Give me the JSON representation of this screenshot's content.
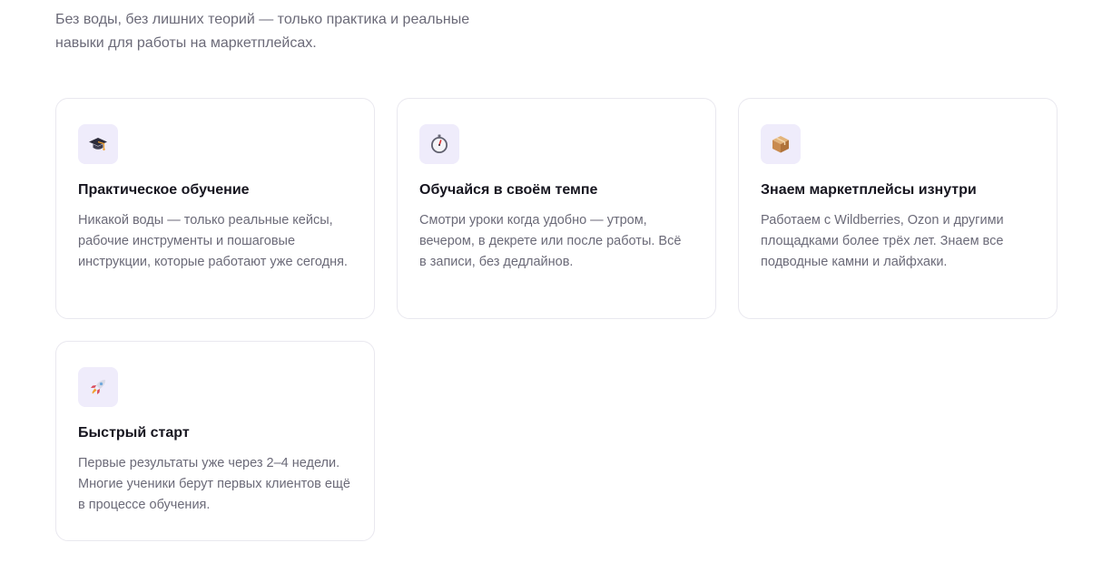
{
  "intro": {
    "text_line1": "Без воды, без лишних теорий — только практика и реальные",
    "text_line2": "навыки для работы на маркетплейсах."
  },
  "features": [
    {
      "icon": "graduation-cap-icon",
      "title": "Практическое обучение",
      "text": "Никакой воды — только реальные кейсы, рабочие инструменты и пошаговые инструкции, которые работают уже сегодня."
    },
    {
      "icon": "stopwatch-icon",
      "title": "Обучайся в своём темпе",
      "text": "Смотри уроки когда удобно — утром, вечером, в декрете или после работы. Всё в записи, без дедлайнов."
    },
    {
      "icon": "package-icon",
      "title": "Знаем маркетплейсы изнутри",
      "text": "Работаем с Wildberries, Ozon и другими площадками более трёх лет. Знаем все подводные камни и лайфхаки."
    },
    {
      "icon": "rocket-icon",
      "title": "Быстрый старт",
      "text": "Первые результаты уже через 2–4 недели. Многие ученики берут первых клиентов ещё в процессе обучения."
    }
  ],
  "colors": {
    "icon_bg": "#efecfb",
    "card_border": "#e9e8ef",
    "text_muted": "#6b6a78",
    "title": "#16151f"
  }
}
